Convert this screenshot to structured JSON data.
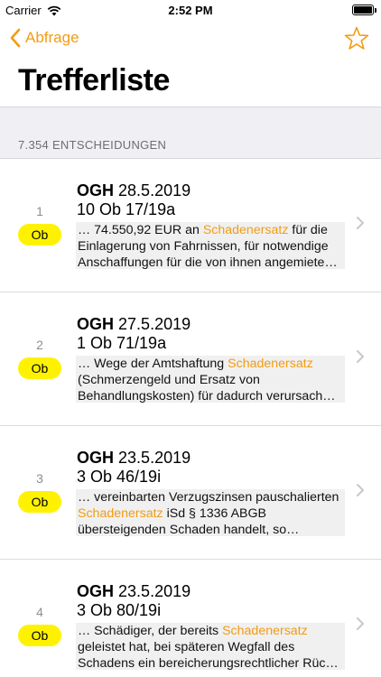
{
  "status_bar": {
    "carrier": "Carrier",
    "time": "2:52 PM"
  },
  "nav": {
    "back_label": "Abfrage",
    "accent_color": "#f39c12"
  },
  "title": "Trefferliste",
  "section_header": "7.354 ENTSCHEIDUNGEN",
  "badge_color": "#fff200",
  "results": [
    {
      "index": "1",
      "badge": "Ob",
      "court": "OGH",
      "date": "28.5.2019",
      "case": "10 Ob 17/19a",
      "snippet_before": "… 74.550,92 EUR an ",
      "snippet_highlight": "Schadenersatz",
      "snippet_after": " für die Einlagerung von Fahrnissen, für notwendige Anschaffungen für die von ihnen angemiete…"
    },
    {
      "index": "2",
      "badge": "Ob",
      "court": "OGH",
      "date": "27.5.2019",
      "case": "1 Ob 71/19a",
      "snippet_before": "… Wege der Amtshaftung ",
      "snippet_highlight": "Schadenersatz",
      "snippet_after": " (Schmerzengeld und Ersatz von Behandlungskosten) für dadurch verursach…"
    },
    {
      "index": "3",
      "badge": "Ob",
      "court": "OGH",
      "date": "23.5.2019",
      "case": "3 Ob 46/19i",
      "snippet_before": "… vereinbarten Verzugszinsen pauschalierten ",
      "snippet_highlight": "Schadenersatz",
      "snippet_after": " iSd § 1336 ABGB übersteigenden Schaden handelt, so…"
    },
    {
      "index": "4",
      "badge": "Ob",
      "court": "OGH",
      "date": "23.5.2019",
      "case": "3 Ob 80/19i",
      "snippet_before": "… Schädiger, der bereits ",
      "snippet_highlight": "Schadenersatz",
      "snippet_after": " geleistet hat, bei späteren Wegfall des Schadens ein bereicherungsrechtlicher Rüc…"
    }
  ]
}
